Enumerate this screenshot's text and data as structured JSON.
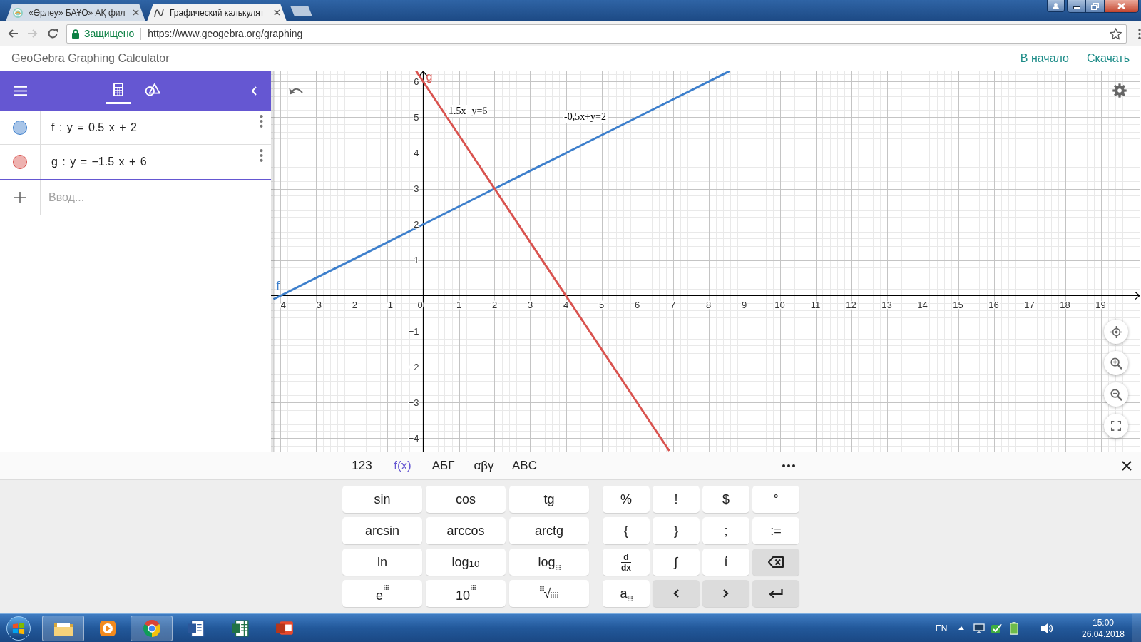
{
  "browser": {
    "tabs": [
      {
        "kind": "emblem",
        "title": "«Өрлеу» БАҰО» АҚ фил",
        "selected": false
      },
      {
        "kind": "graph",
        "title": "Графический калькулят",
        "selected": true
      }
    ],
    "forward_disabled": true,
    "security_label": "Защищено",
    "url": "https://www.geogebra.org/graphing"
  },
  "app_header": {
    "title": "GeoGebra Graphing Calculator",
    "links": [
      "В начало",
      "Скачать"
    ]
  },
  "side_panel": {
    "view_tabs": [
      {
        "kind": "algebra",
        "selected": true
      },
      {
        "kind": "tools",
        "selected": false
      }
    ],
    "items": [
      {
        "definition": "f : y = 0.5 x + 2",
        "color": "#3d7fcc",
        "visible": true
      },
      {
        "definition": "g : y = −1.5 x + 6",
        "color": "#d9534f",
        "visible": true
      }
    ],
    "input_placeholder": "Ввод..."
  },
  "graph": {
    "chart_data": {
      "type": "line",
      "grid": true,
      "x": [
        -4.2,
        -0.2,
        0,
        2,
        4,
        6.9,
        8.6
      ],
      "series": [
        {
          "name": "f",
          "color": "#3d7fcc",
          "values": [
            -0.1,
            1.9,
            2,
            3,
            4,
            5.45,
            6.3
          ]
        },
        {
          "name": "g",
          "color": "#d9534f",
          "values": [
            null,
            6.3,
            6,
            3,
            0,
            -4.35,
            null
          ]
        }
      ],
      "xlim": [
        -4.27,
        20.11
      ],
      "ylim": [
        -4.37,
        6.31
      ],
      "xticks": [
        {
          "value": -4,
          "label": "−4"
        },
        {
          "value": -3,
          "label": "−3"
        },
        {
          "value": -2,
          "label": "−2"
        },
        {
          "value": -1,
          "label": "−1"
        },
        {
          "value": 0,
          "label": "0"
        },
        1,
        2,
        3,
        4,
        5,
        6,
        7,
        8,
        9,
        10,
        11,
        12,
        13,
        14,
        15,
        16,
        17,
        18,
        19
      ],
      "yticks": [
        {
          "value": -4,
          "label": "−4"
        },
        {
          "value": -3,
          "label": "−3"
        },
        {
          "value": -2,
          "label": "−2"
        },
        {
          "value": -1,
          "label": "−1"
        },
        1,
        2,
        3,
        4,
        5,
        6
      ],
      "annotations": [
        "1.5x+y=6",
        "-0,5x+y=2"
      ]
    }
  },
  "keyboard": {
    "tabs": [
      {
        "label": "123",
        "selected": false
      },
      {
        "label": "f(x)",
        "selected": true
      },
      {
        "label": "АБГ",
        "selected": false
      },
      {
        "label": "αβγ",
        "selected": false
      },
      {
        "label": "ABC",
        "selected": false
      }
    ],
    "function_keys": [
      {
        "kind": "text",
        "label": "sin"
      },
      {
        "kind": "text",
        "label": "cos"
      },
      {
        "kind": "text",
        "label": "tg"
      },
      {
        "kind": "text",
        "label": "arcsin"
      },
      {
        "kind": "text",
        "label": "arccos"
      },
      {
        "kind": "text",
        "label": "arctg"
      },
      {
        "kind": "text",
        "label": "ln"
      },
      {
        "kind": "text",
        "label": "log$_{10}$"
      },
      {
        "kind": "sub_box",
        "label": "log"
      },
      {
        "kind": "sup_box",
        "label": "e"
      },
      {
        "kind": "sup_box",
        "label": "10"
      },
      {
        "kind": "root",
        "label": "√"
      }
    ],
    "symbol_keys": [
      {
        "kind": "text",
        "label": "%"
      },
      {
        "kind": "text",
        "label": "!"
      },
      {
        "kind": "text",
        "label": "$"
      },
      {
        "kind": "text",
        "label": "°"
      },
      {
        "kind": "text",
        "label": "{"
      },
      {
        "kind": "text",
        "label": "}"
      },
      {
        "kind": "text",
        "label": ";"
      },
      {
        "kind": "text",
        "label": ":="
      },
      {
        "kind": "fraction",
        "numerator": "d",
        "denominator": "dx"
      },
      {
        "kind": "text",
        "label": "∫"
      },
      {
        "kind": "text",
        "label": "ί"
      },
      {
        "kind": "backspace"
      },
      {
        "kind": "sub_box",
        "label": "a"
      },
      {
        "kind": "left"
      },
      {
        "kind": "right"
      },
      {
        "kind": "enter"
      }
    ]
  },
  "taskbar": {
    "apps": [
      {
        "kind": "folder",
        "running": true
      },
      {
        "kind": "player",
        "running": false
      },
      {
        "kind": "browser",
        "running": true
      },
      {
        "kind": "document",
        "running": false
      },
      {
        "kind": "spreadsheet",
        "running": false
      },
      {
        "kind": "presentation",
        "running": false
      }
    ],
    "language": "EN",
    "time": "15:00",
    "date": "26.04.2018"
  }
}
